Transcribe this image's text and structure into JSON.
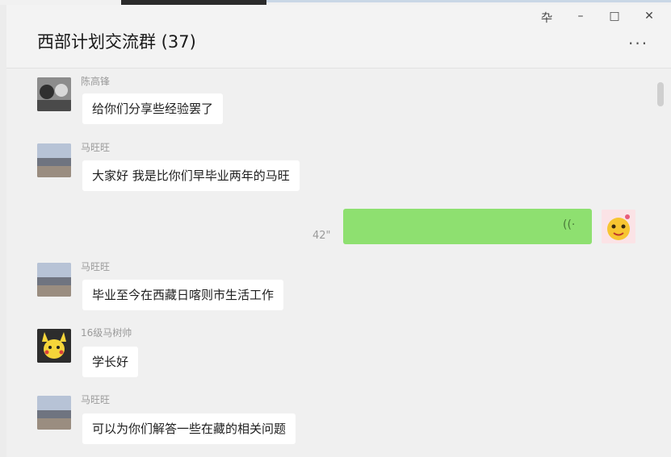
{
  "window": {
    "title": "西部计划交流群 (37)",
    "controls": {
      "pin": "卆",
      "minimize": "–",
      "maximize": "□",
      "close": "✕"
    },
    "more": "···"
  },
  "messages": [
    {
      "sender": "陈高锋",
      "text": "给你们分享些经验罢了"
    },
    {
      "sender": "马旺旺",
      "text": "大家好 我是比你们早毕业两年的马旺"
    },
    {
      "self": true,
      "type": "voice",
      "duration": "42\"",
      "voice_icon": "((·"
    },
    {
      "sender": "马旺旺",
      "text": "毕业至今在西藏日喀则市生活工作"
    },
    {
      "sender": "16级马树帅",
      "text": "学长好"
    },
    {
      "sender": "马旺旺",
      "text": "可以为你们解答一些在藏的相关问题"
    }
  ]
}
